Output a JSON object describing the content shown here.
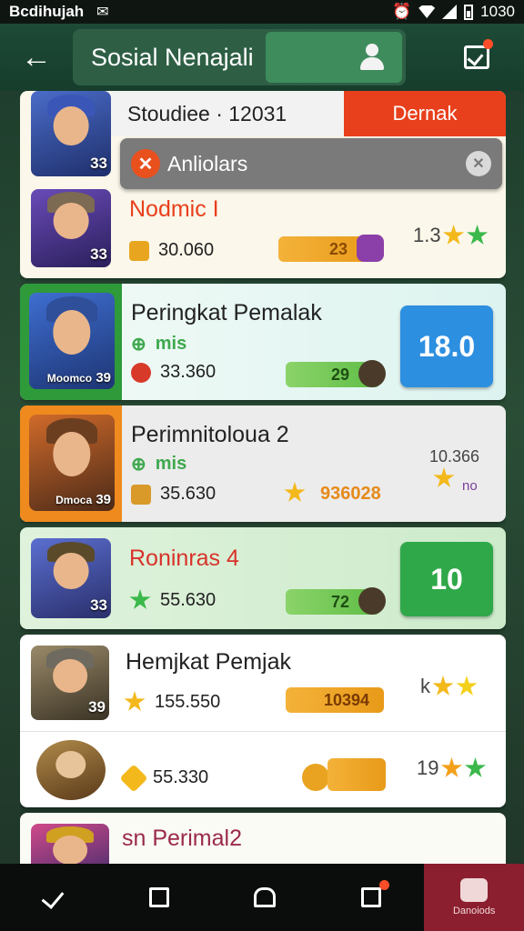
{
  "status_bar": {
    "carrier": "Bcdihujah",
    "time": "1030"
  },
  "header": {
    "title": "Sosial Nenajali"
  },
  "banner": {
    "text": "Stoudiee · 12031",
    "button": "Dernak"
  },
  "search_chip": {
    "label": "Anliolars"
  },
  "entries": [
    {
      "name": "Nodmic I",
      "level": "33",
      "coins": "30.060",
      "pill": "23",
      "rating_text": "1.3",
      "stars": 2
    },
    {
      "name": "Peringkat Pemalak",
      "sub": "mis",
      "level": "39",
      "level_label": "Moomco",
      "coins": "33.360",
      "pill": "29",
      "score": "18.0",
      "score_color": "#2d8fe0"
    },
    {
      "name": "Perimnitoloua 2",
      "sub": "mis",
      "level": "39",
      "level_label": "Dmoca",
      "coins": "35.630",
      "pill": "936028",
      "rating_text": "10.366",
      "rating_sub": "no"
    },
    {
      "name": "Roninras 4",
      "level": "33",
      "coins": "55.630",
      "pill": "72",
      "score": "10",
      "score_color": "#2fa84a"
    },
    {
      "name": "Hemjkat Pemjak",
      "level": "39",
      "coins": "155.550",
      "pill": "10394",
      "rating_text": "k"
    },
    {
      "name": "",
      "level": "",
      "coins": "55.330",
      "rating_text": "19"
    },
    {
      "name": "sn Perimal2"
    }
  ],
  "navbar": {
    "active_label": "Danoiods"
  },
  "colors": {
    "accent": "#e8501e",
    "header": "#1d4a36",
    "green": "#2fa84a",
    "blue": "#2d8fe0"
  }
}
